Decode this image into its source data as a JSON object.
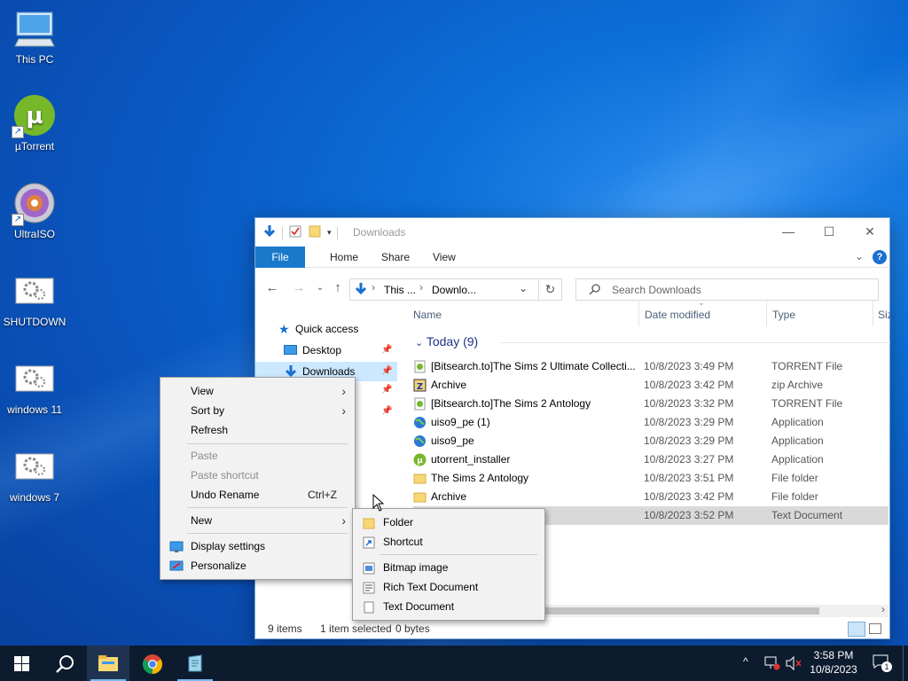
{
  "desktop": {
    "icons": [
      {
        "label": "This PC"
      },
      {
        "label": "µTorrent"
      },
      {
        "label": "UltraISO"
      },
      {
        "label": "SHUTDOWN"
      },
      {
        "label": "windows 11"
      },
      {
        "label": "windows 7"
      }
    ]
  },
  "explorer": {
    "title": "Downloads",
    "ribbon_tabs": [
      "File",
      "Home",
      "Share",
      "View"
    ],
    "breadcrumb": [
      "This ...",
      "Downlo..."
    ],
    "search_placeholder": "Search Downloads",
    "nav": [
      {
        "label": "Quick access"
      },
      {
        "label": "Desktop"
      },
      {
        "label": "Downloads"
      }
    ],
    "columns": [
      "Name",
      "Date modified",
      "Type",
      "Siz"
    ],
    "group": "Today (9)",
    "files": [
      {
        "name": "[Bitsearch.to]The Sims 2 Ultimate Collecti...",
        "date": "10/8/2023 3:49 PM",
        "type": "TORRENT File",
        "icon": "torrent-file-icon"
      },
      {
        "name": "Archive",
        "date": "10/8/2023 3:42 PM",
        "type": "zip Archive",
        "icon": "zip-archive-icon"
      },
      {
        "name": "[Bitsearch.to]The Sims 2 Antology",
        "date": "10/8/2023 3:32 PM",
        "type": "TORRENT File",
        "icon": "torrent-file-icon"
      },
      {
        "name": "uiso9_pe (1)",
        "date": "10/8/2023 3:29 PM",
        "type": "Application",
        "icon": "installer-globe-icon"
      },
      {
        "name": "uiso9_pe",
        "date": "10/8/2023 3:29 PM",
        "type": "Application",
        "icon": "installer-globe-icon"
      },
      {
        "name": "utorrent_installer",
        "date": "10/8/2023 3:27 PM",
        "type": "Application",
        "icon": "utorrent-icon"
      },
      {
        "name": "The Sims 2 Antology",
        "date": "10/8/2023 3:51 PM",
        "type": "File folder",
        "icon": "folder-icon"
      },
      {
        "name": "Archive",
        "date": "10/8/2023 3:42 PM",
        "type": "File folder",
        "icon": "folder-icon"
      },
      {
        "name": "",
        "date": "10/8/2023 3:52 PM",
        "type": "Text Document",
        "icon": "text-document-icon"
      }
    ],
    "status": {
      "count": "9 items",
      "selection": "1 item selected",
      "size": "0 bytes"
    }
  },
  "context_menu": {
    "view": "View",
    "sort_by": "Sort by",
    "refresh": "Refresh",
    "paste": "Paste",
    "paste_shortcut": "Paste shortcut",
    "undo_rename": "Undo Rename",
    "undo_shortcut": "Ctrl+Z",
    "new": "New",
    "display_settings": "Display settings",
    "personalize": "Personalize"
  },
  "new_submenu": {
    "folder": "Folder",
    "shortcut": "Shortcut",
    "bitmap": "Bitmap image",
    "rtf": "Rich Text Document",
    "text": "Text Document"
  },
  "taskbar": {
    "time": "3:58 PM",
    "date": "10/8/2023",
    "notification_count": "1"
  },
  "colors": {
    "accent": "#1979ca",
    "desktop": "#0a58c2",
    "taskbar": "#0d1b2e"
  }
}
